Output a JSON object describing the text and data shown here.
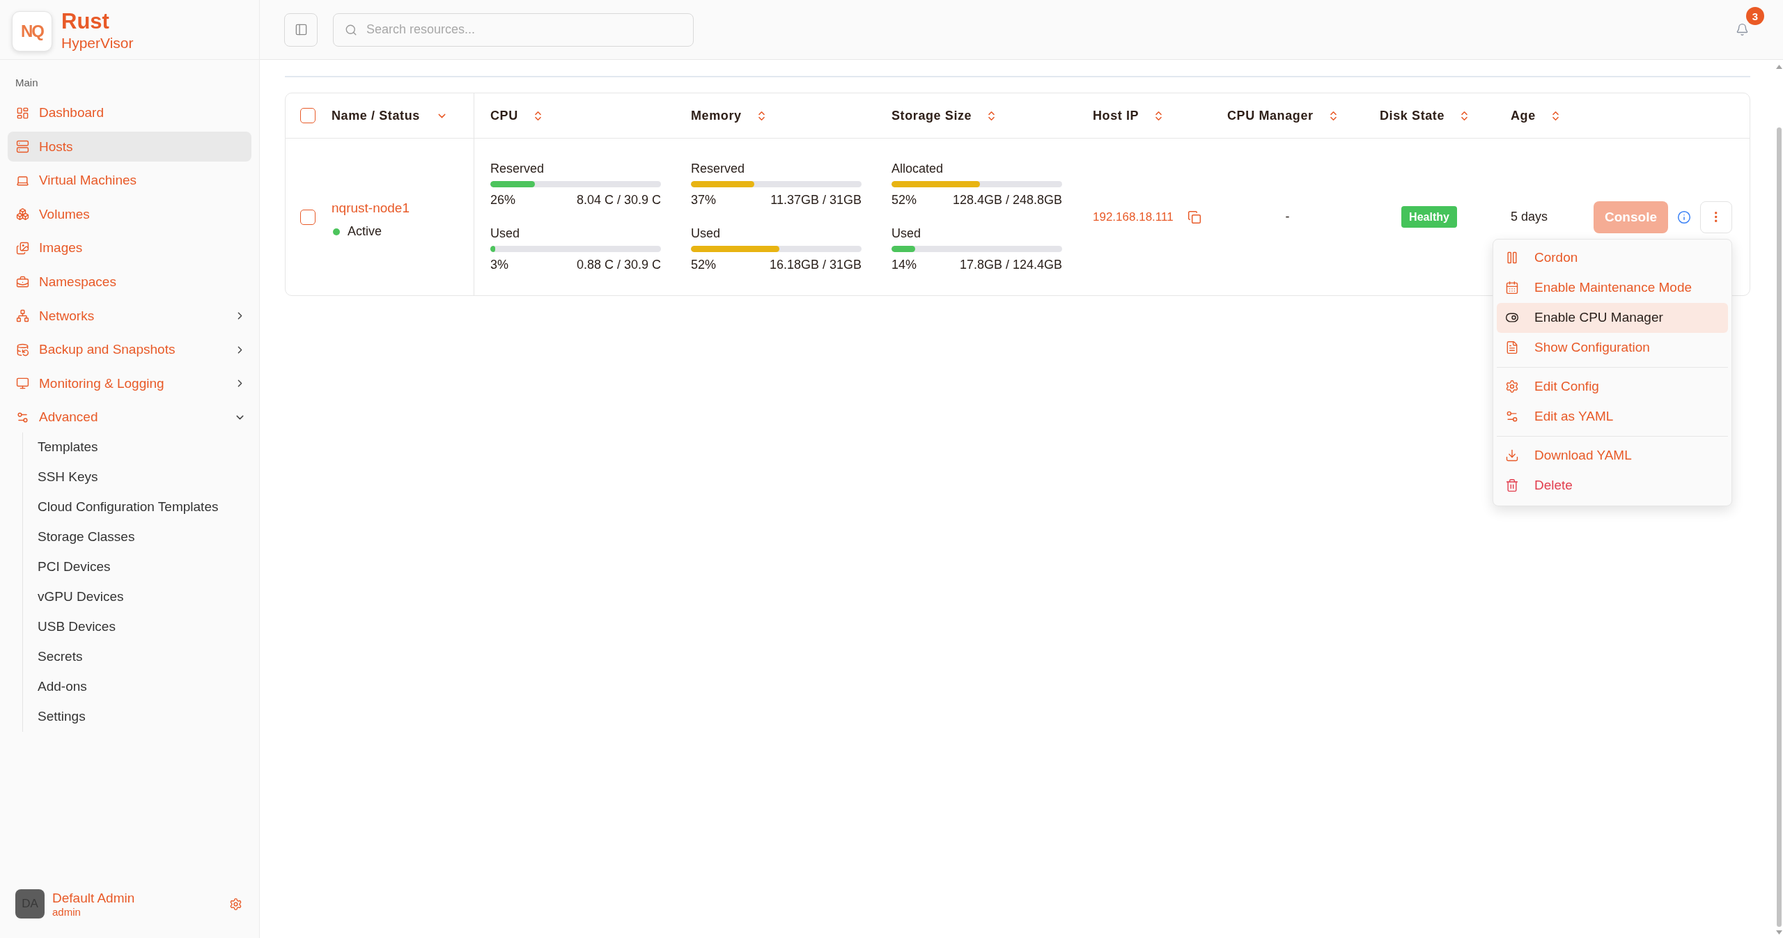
{
  "sidebar": {
    "brand": {
      "logo": "NQ",
      "title": "Rust",
      "subtitle": "HyperVisor"
    },
    "section_label": "Main",
    "items": [
      {
        "label": "Dashboard",
        "selected": false
      },
      {
        "label": "Hosts",
        "selected": true
      },
      {
        "label": "Virtual Machines",
        "selected": false
      },
      {
        "label": "Volumes",
        "selected": false
      },
      {
        "label": "Images",
        "selected": false
      },
      {
        "label": "Namespaces",
        "selected": false
      },
      {
        "label": "Networks",
        "selected": false,
        "expanded": false
      },
      {
        "label": "Backup and Snapshots",
        "selected": false,
        "expanded": false
      },
      {
        "label": "Monitoring & Logging",
        "selected": false,
        "expanded": false
      },
      {
        "label": "Advanced",
        "selected": false,
        "expanded": true,
        "children": [
          {
            "label": "Templates",
            "selected": false
          },
          {
            "label": "SSH Keys",
            "selected": false
          },
          {
            "label": "Cloud Configuration Templates",
            "selected": false
          },
          {
            "label": "Storage Classes",
            "selected": false
          },
          {
            "label": "PCI Devices",
            "selected": false
          },
          {
            "label": "vGPU Devices",
            "selected": false
          },
          {
            "label": "USB Devices",
            "selected": false
          },
          {
            "label": "Secrets",
            "selected": false
          },
          {
            "label": "Add-ons",
            "selected": false
          },
          {
            "label": "Settings",
            "selected": false
          }
        ]
      }
    ],
    "user": {
      "initials": "DA",
      "name": "Default Admin",
      "role": "admin"
    }
  },
  "topbar": {
    "search": {
      "placeholder": "Search resources..."
    },
    "notification_count": "3"
  },
  "table": {
    "select_all": {
      "checked": false
    },
    "columns": [
      {
        "label": "Name / Status",
        "sorted": true
      },
      {
        "label": "CPU",
        "sorted": false
      },
      {
        "label": "Memory",
        "sorted": false
      },
      {
        "label": "Storage Size",
        "sorted": false
      },
      {
        "label": "Host IP",
        "sorted": false
      },
      {
        "label": "CPU Manager",
        "sorted": false
      },
      {
        "label": "Disk State",
        "sorted": false
      },
      {
        "label": "Age",
        "sorted": false
      }
    ],
    "rows": [
      {
        "checked": false,
        "name": "nqrust-node1",
        "status": {
          "label": "Active",
          "color": "#4cc45c"
        },
        "cpu": [
          {
            "label": "Reserved",
            "level": 0.26,
            "color": "#4cc45c",
            "percent": "26%",
            "reading": "8.04 C / 30.9 C"
          },
          {
            "label": "Used",
            "level": 0.03,
            "color": "#4cc45c",
            "percent": "3%",
            "reading": "0.88 C / 30.9 C"
          }
        ],
        "memory": [
          {
            "label": "Reserved",
            "level": 0.37,
            "color": "#e8b412",
            "percent": "37%",
            "reading": "11.37GB / 31GB"
          },
          {
            "label": "Used",
            "level": 0.52,
            "color": "#e8b412",
            "percent": "52%",
            "reading": "16.18GB / 31GB"
          }
        ],
        "storage": [
          {
            "label": "Allocated",
            "level": 0.52,
            "color": "#e8b412",
            "percent": "52%",
            "reading": "128.4GB / 248.8GB"
          },
          {
            "label": "Used",
            "level": 0.14,
            "color": "#4cc45c",
            "percent": "14%",
            "reading": "17.8GB / 124.4GB"
          }
        ],
        "host_ip": "192.168.18.111",
        "cpu_manager": "-",
        "disk_state": "Healthy",
        "age": "5 days",
        "console_label": "Console"
      }
    ]
  },
  "action_menu": {
    "groups": [
      {
        "items": [
          {
            "label": "Cordon",
            "selected": false,
            "kind": "default"
          },
          {
            "label": "Enable Maintenance Mode",
            "selected": false,
            "kind": "default"
          },
          {
            "label": "Enable CPU Manager",
            "selected": true,
            "kind": "default"
          },
          {
            "label": "Show Configuration",
            "selected": false,
            "kind": "default"
          }
        ]
      },
      {
        "items": [
          {
            "label": "Edit Config",
            "selected": false,
            "kind": "default"
          },
          {
            "label": "Edit as YAML",
            "selected": false,
            "kind": "default"
          }
        ]
      },
      {
        "items": [
          {
            "label": "Download YAML",
            "selected": false,
            "kind": "default"
          },
          {
            "label": "Delete",
            "selected": false,
            "kind": "danger"
          }
        ]
      }
    ]
  }
}
